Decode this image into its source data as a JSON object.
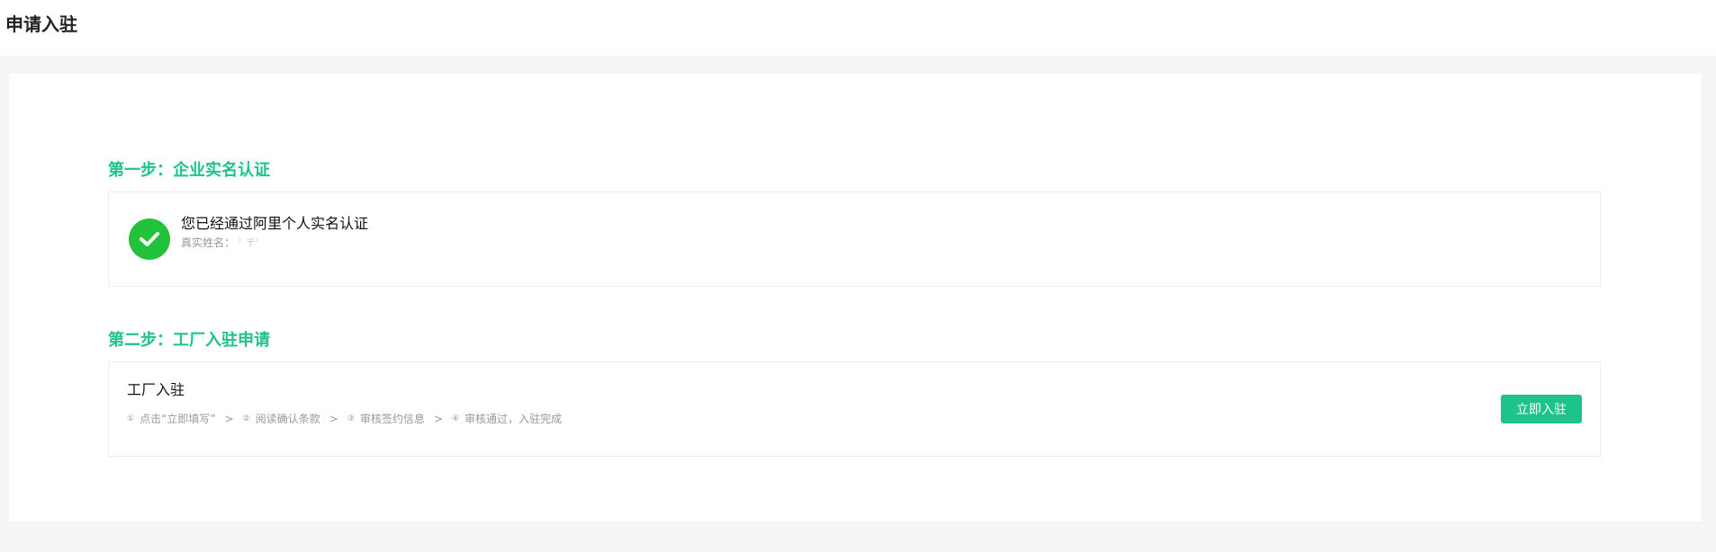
{
  "page": {
    "title": "申请入驻"
  },
  "colors": {
    "accent": "#1ec38a",
    "check": "#22c33a"
  },
  "step1": {
    "title": "第一步：企业实名认证",
    "status_icon": "check-circle-icon",
    "verified_text": "您已经通过阿里个人实名认证",
    "name_label": "真实姓名：",
    "name_value": "' 〒'"
  },
  "step2": {
    "title": "第二步：工厂入驻申请",
    "card_title": "工厂入驻",
    "process": [
      {
        "num": "①",
        "label": "点击“立即填写”"
      },
      {
        "num": "②",
        "label": "阅读确认条款"
      },
      {
        "num": "③",
        "label": "审核签约信息"
      },
      {
        "num": "④",
        "label": "审核通过，入驻完成"
      }
    ],
    "separator": ">",
    "button_label": "立即入驻"
  }
}
